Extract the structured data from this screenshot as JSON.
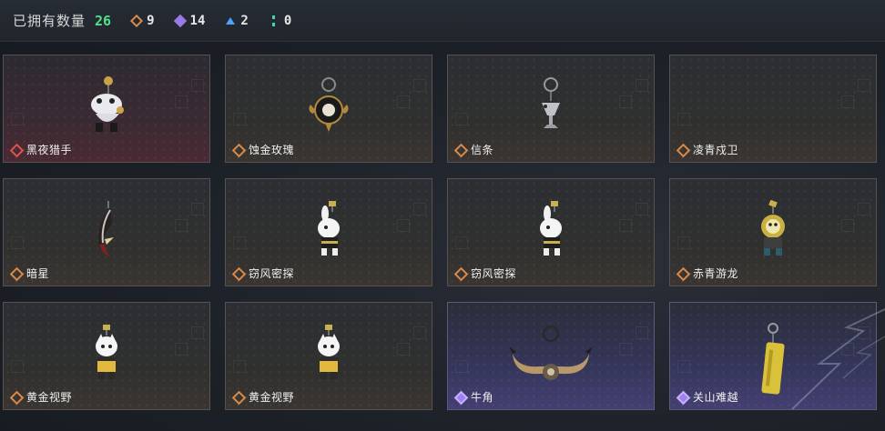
{
  "header": {
    "title": "已拥有数量",
    "total": "26",
    "stats": [
      {
        "icon": "orange-diamond-icon",
        "value": "9",
        "color": "#d98a4a"
      },
      {
        "icon": "purple-diamond-icon",
        "value": "14",
        "color": "#9a79e8"
      },
      {
        "icon": "blue-triangle-icon",
        "value": "2",
        "color": "#4aa3ff"
      },
      {
        "icon": "teal-bar-icon",
        "value": "0",
        "color": "#39d9b7"
      }
    ]
  },
  "items": [
    {
      "name": "黑夜猎手",
      "rarity": "red",
      "charm": "white-cat-figure-icon"
    },
    {
      "name": "蚀金玫瑰",
      "rarity": "orange",
      "charm": "dark-rose-medallion-icon"
    },
    {
      "name": "信条",
      "rarity": "orange",
      "charm": "silver-goblet-icon"
    },
    {
      "name": "凌青戍卫",
      "rarity": "orange",
      "charm": ""
    },
    {
      "name": "暗星",
      "rarity": "orange",
      "charm": "crescent-feather-icon"
    },
    {
      "name": "窃风密探",
      "rarity": "orange",
      "charm": "white-rabbit-figure-icon"
    },
    {
      "name": "窃风密探",
      "rarity": "orange",
      "charm": "white-rabbit-figure-icon"
    },
    {
      "name": "赤青游龙",
      "rarity": "orange",
      "charm": "lion-dragon-figure-icon"
    },
    {
      "name": "黄金视野",
      "rarity": "orange",
      "charm": "white-cat-yellow-robe-icon"
    },
    {
      "name": "黄金视野",
      "rarity": "orange",
      "charm": "white-cat-yellow-robe-icon"
    },
    {
      "name": "牛角",
      "rarity": "purple",
      "charm": "bull-horn-icon"
    },
    {
      "name": "关山难越",
      "rarity": "purple",
      "charm": "gold-bar-icon"
    }
  ]
}
